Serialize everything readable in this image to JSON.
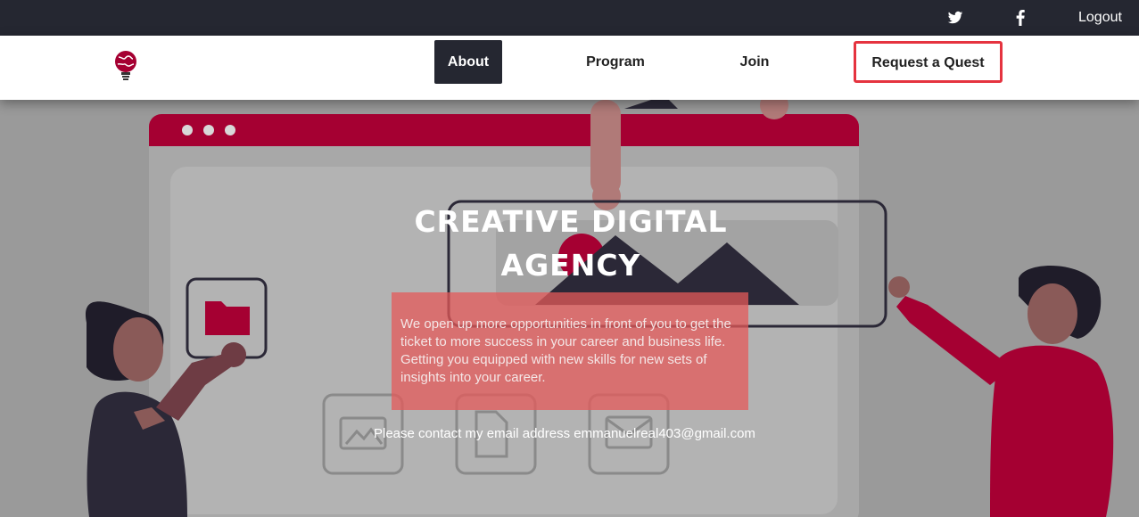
{
  "topbar": {
    "twitter_icon": "twitter-icon",
    "facebook_icon": "facebook-icon",
    "logout_label": "Logout"
  },
  "nav": {
    "logo_icon": "globe-bulb-logo",
    "items": [
      {
        "label": "About",
        "active": true
      },
      {
        "label": "Program"
      },
      {
        "label": "Join"
      }
    ],
    "cta_label": "Request a Quest"
  },
  "hero": {
    "title_line1": "CREATIVE DIGITAL",
    "title_line2": "AGENCY",
    "description": "We open up more opportunities in front of you to get the ticket to more success in your career and business life. Getting you equipped with new skills for new sets of insights into your career.",
    "contact": "Please contact my email address emmanuelreal403@gmail.com"
  },
  "colors": {
    "topbar_bg": "#252731",
    "accent_red": "#a50032",
    "cta_border": "#e5333f",
    "overlay_bg": "#9a9a9a"
  }
}
